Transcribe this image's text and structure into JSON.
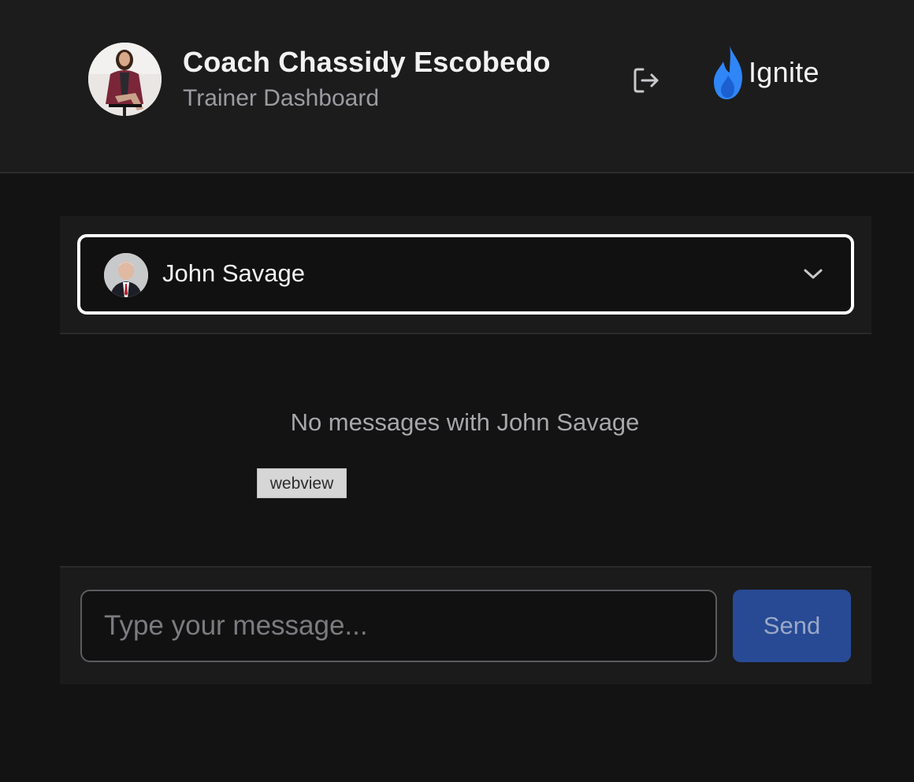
{
  "header": {
    "trainer_name": "Coach Chassidy Escobedo",
    "subtitle": "Trainer Dashboard",
    "logout_icon": "logout-icon",
    "logo": {
      "icon": "flame-icon",
      "text": "Ignite",
      "color": "#2f86f6"
    }
  },
  "client_selector": {
    "selected_client": "John Savage",
    "icon": "chevron-down-icon"
  },
  "messages": {
    "empty_text": "No messages with John Savage",
    "debug_tag": "webview"
  },
  "composer": {
    "input_value": "",
    "input_placeholder": "Type your message...",
    "send_label": "Send",
    "send_color": "#284a94"
  }
}
